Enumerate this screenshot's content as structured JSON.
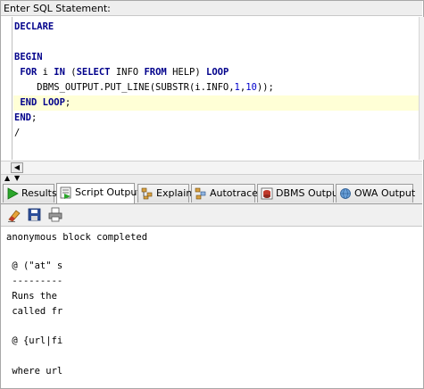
{
  "sql_label": "Enter SQL Statement:",
  "code_lines": [
    [
      {
        "t": "DECLARE",
        "k": 1
      }
    ],
    [],
    [
      {
        "t": "BEGIN",
        "k": 1
      }
    ],
    [
      {
        "t": " "
      },
      {
        "t": "FOR",
        "k": 1
      },
      {
        "t": " i "
      },
      {
        "t": "IN",
        "k": 1
      },
      {
        "t": " ("
      },
      {
        "t": "SELECT",
        "k": 1
      },
      {
        "t": " INFO "
      },
      {
        "t": "FROM",
        "k": 1
      },
      {
        "t": " HELP) "
      },
      {
        "t": "LOOP",
        "k": 1
      }
    ],
    [
      {
        "t": "    DBMS_OUTPUT.PUT_LINE(SUBSTR(i.INFO,"
      },
      {
        "t": "1",
        "n": 1
      },
      {
        "t": ","
      },
      {
        "t": "10",
        "n": 1
      },
      {
        "t": "));"
      }
    ],
    [
      {
        "t": " "
      },
      {
        "t": "END",
        "k": 1
      },
      {
        "t": " "
      },
      {
        "t": "LOOP",
        "k": 1
      },
      {
        "t": ";"
      }
    ],
    [
      {
        "t": "END",
        "k": 1
      },
      {
        "t": ";"
      }
    ],
    [
      {
        "t": "/"
      }
    ]
  ],
  "highlighted_line": 5,
  "tabs": {
    "results": "Results",
    "script_output": "Script Output",
    "explain": "Explain",
    "autotrace": "Autotrace",
    "dbms_output": "DBMS Output",
    "owa_output": "OWA Output"
  },
  "output_lines": [
    "anonymous block completed",
    "",
    " @ (\"at\" s",
    " ---------",
    " Runs the",
    " called fr",
    "",
    " @ {url|fi",
    "",
    " where url"
  ],
  "colors": {
    "keyword": "#00008b",
    "number": "#0000cc",
    "line_highlight": "#ffffd6"
  }
}
